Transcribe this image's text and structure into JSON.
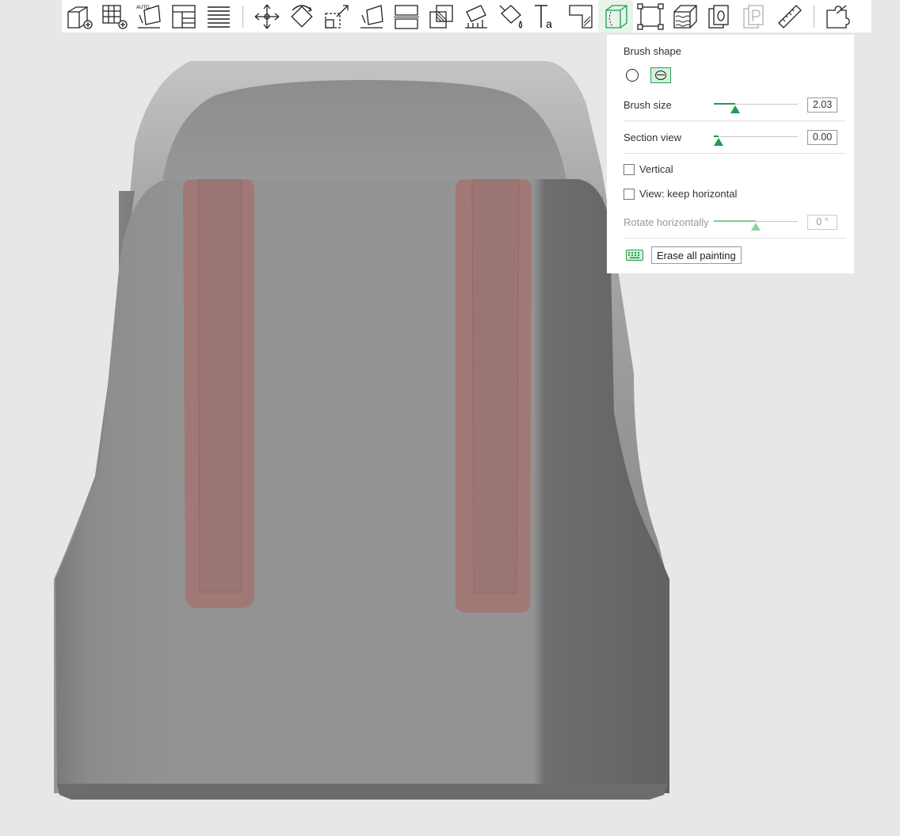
{
  "toolbar": {
    "tools": [
      {
        "icon": "add-cube-icon"
      },
      {
        "icon": "add-plate-icon"
      },
      {
        "icon": "auto-orient-icon"
      },
      {
        "icon": "arrange-icon"
      },
      {
        "icon": "layers-list-icon"
      },
      {
        "sep": true
      },
      {
        "icon": "move-icon"
      },
      {
        "icon": "rotate-icon"
      },
      {
        "icon": "scale-icon"
      },
      {
        "icon": "lay-on-face-icon"
      },
      {
        "icon": "cut-icon"
      },
      {
        "icon": "mesh-boolean-icon"
      },
      {
        "icon": "support-paint-icon"
      },
      {
        "icon": "color-paint-icon"
      },
      {
        "icon": "text-icon"
      },
      {
        "icon": "measure-corner-icon"
      },
      {
        "icon": "seam-paint-icon",
        "active": true
      },
      {
        "icon": "variable-layer-height-icon"
      },
      {
        "icon": "fuzzy-skin-icon"
      },
      {
        "icon": "assemble-icon"
      },
      {
        "icon": "p-view-icon",
        "disabled": true
      },
      {
        "icon": "ruler-icon"
      },
      {
        "sep": true
      },
      {
        "icon": "split-parts-icon"
      }
    ]
  },
  "panel": {
    "brush_shape_label": "Brush shape",
    "brush_size_label": "Brush size",
    "brush_size_value": "2.03",
    "brush_size_fraction": 0.25,
    "section_view_label": "Section view",
    "section_view_value": "0.00",
    "section_view_fraction": 0.06,
    "vertical_label": "Vertical",
    "keep_horizontal_label": "View: keep horizontal",
    "rotate_label": "Rotate horizontally",
    "rotate_value": "0 °",
    "rotate_fraction": 0.5,
    "erase_label": "Erase all painting"
  },
  "colors": {
    "accent": "#1e9e4a",
    "model": "#8f8f8f",
    "paint": "#a07876",
    "background": "#e7e7e7"
  }
}
